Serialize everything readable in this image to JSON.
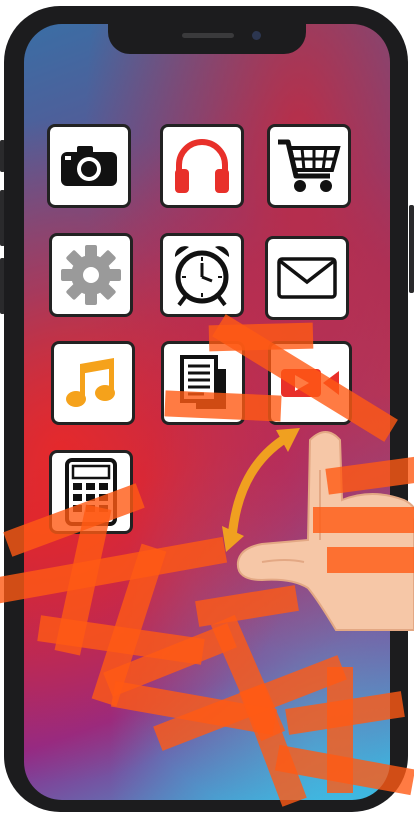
{
  "screen": {
    "title": "",
    "apps": [
      {
        "id": "camera",
        "icon": "camera-icon"
      },
      {
        "id": "headphones",
        "icon": "headphones-icon"
      },
      {
        "id": "cart",
        "icon": "shopping-cart-icon"
      },
      {
        "id": "settings",
        "icon": "gear-icon"
      },
      {
        "id": "alarm",
        "icon": "alarm-clock-icon"
      },
      {
        "id": "mail",
        "icon": "envelope-icon"
      },
      {
        "id": "music",
        "icon": "music-note-icon"
      },
      {
        "id": "documents",
        "icon": "documents-icon"
      },
      {
        "id": "video",
        "icon": "video-camera-icon"
      },
      {
        "id": "calculator",
        "icon": "calculator-icon"
      }
    ]
  },
  "gesture": {
    "icon": "pointing-hand-icon",
    "arrow": "double-arrow-icon",
    "arrow_color": "#f0a020"
  },
  "watermark": {
    "text": "",
    "color": "#ff5a14"
  },
  "colors": {
    "accent_red": "#e8302a",
    "gear_gray": "#9a9a9a",
    "music_orange": "#f5a21b",
    "border": "#222222"
  }
}
